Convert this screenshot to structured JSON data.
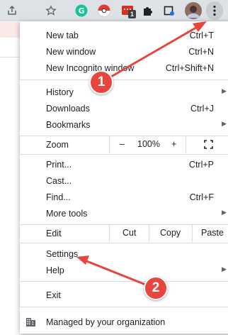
{
  "toolbar": {
    "icons": [
      "share-icon",
      "bookmark-star-icon",
      "grammarly-icon",
      "pokeball-icon",
      "extension-calendar-icon",
      "puzzle-extensions-icon",
      "media-cast-icon",
      "profile-avatar",
      "kebab-menu-icon"
    ],
    "extension_badge": "1"
  },
  "menu": {
    "new_tab": {
      "label": "New tab",
      "shortcut": "Ctrl+T"
    },
    "new_window": {
      "label": "New window",
      "shortcut": "Ctrl+N"
    },
    "new_incognito": {
      "label": "New Incognito window",
      "shortcut": "Ctrl+Shift+N"
    },
    "history": {
      "label": "History"
    },
    "downloads": {
      "label": "Downloads",
      "shortcut": "Ctrl+J"
    },
    "bookmarks": {
      "label": "Bookmarks"
    },
    "zoom": {
      "label": "Zoom",
      "minus": "–",
      "value": "100%",
      "plus": "+"
    },
    "print": {
      "label": "Print...",
      "shortcut": "Ctrl+P"
    },
    "cast": {
      "label": "Cast..."
    },
    "find": {
      "label": "Find...",
      "shortcut": "Ctrl+F"
    },
    "more_tools": {
      "label": "More tools"
    },
    "edit": {
      "label": "Edit",
      "cut": "Cut",
      "copy": "Copy",
      "paste": "Paste"
    },
    "settings": {
      "label": "Settings"
    },
    "help": {
      "label": "Help"
    },
    "exit": {
      "label": "Exit"
    },
    "managed": {
      "label": "Managed by your organization"
    }
  },
  "annotations": {
    "badge1": "1",
    "badge2": "2",
    "color": "#e8453c"
  }
}
